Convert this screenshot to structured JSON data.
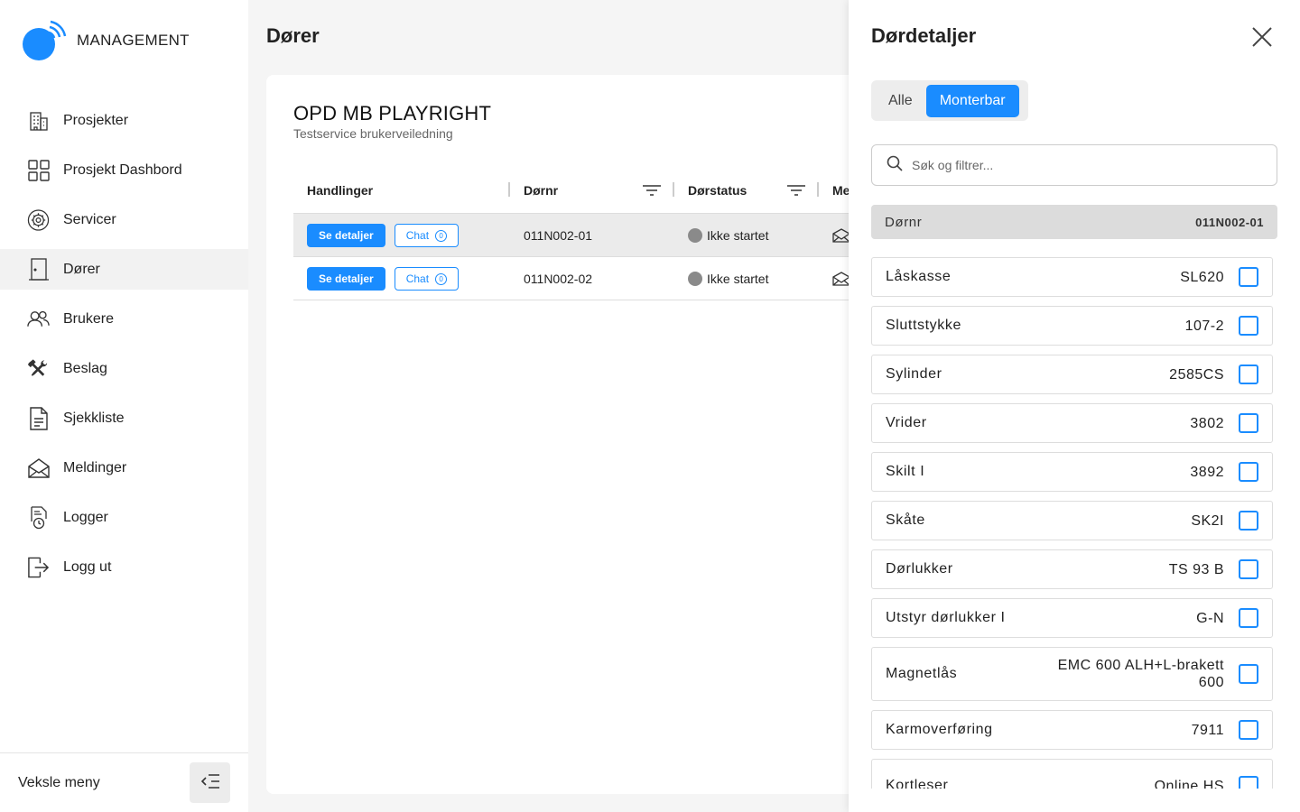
{
  "app": {
    "brand": "MANAGEMENT"
  },
  "sidebar": {
    "items": [
      {
        "label": "Prosjekter",
        "icon": "building-icon"
      },
      {
        "label": "Prosjekt Dashbord",
        "icon": "dashboard-grid-icon"
      },
      {
        "label": "Servicer",
        "icon": "gear-icon"
      },
      {
        "label": "Dører",
        "icon": "door-icon",
        "active": true
      },
      {
        "label": "Brukere",
        "icon": "users-icon"
      },
      {
        "label": "Beslag",
        "icon": "tools-icon"
      },
      {
        "label": "Sjekkliste",
        "icon": "document-icon"
      },
      {
        "label": "Meldinger",
        "icon": "mail-icon"
      },
      {
        "label": "Logger",
        "icon": "log-clock-icon"
      },
      {
        "label": "Logg ut",
        "icon": "logout-icon"
      }
    ],
    "footer": {
      "label": "Veksle meny"
    }
  },
  "main": {
    "title": "Dører",
    "project": {
      "title": "OPD MB PLAYRIGHT",
      "subtitle": "Testservice brukerveiledning"
    },
    "table": {
      "headers": {
        "actions": "Handlinger",
        "door": "Dørnr",
        "status": "Dørstatus",
        "more": "Me"
      },
      "rows": [
        {
          "details": "Se detaljer",
          "chat": "Chat",
          "chat_count": "0",
          "door": "011N002-01",
          "status": "Ikke startet",
          "selected": true
        },
        {
          "details": "Se detaljer",
          "chat": "Chat",
          "chat_count": "0",
          "door": "011N002-02",
          "status": "Ikke startet",
          "selected": false
        }
      ]
    }
  },
  "drawer": {
    "title": "Dørdetaljer",
    "tabs": {
      "all": "Alle",
      "mountable": "Monterbar"
    },
    "search_placeholder": "Søk og filtrer...",
    "door_label": "Dørnr",
    "door_value": "011N002-01",
    "items": [
      {
        "name": "Låskasse",
        "value": "SL620"
      },
      {
        "name": "Sluttstykke",
        "value": "107-2"
      },
      {
        "name": "Sylinder",
        "value": "2585CS"
      },
      {
        "name": "Vrider",
        "value": "3802"
      },
      {
        "name": "Skilt I",
        "value": "3892"
      },
      {
        "name": "Skåte",
        "value": "SK2I"
      },
      {
        "name": "Dørlukker",
        "value": "TS 93 B"
      },
      {
        "name": "Utstyr dørlukker I",
        "value": "G-N"
      },
      {
        "name": "Magnetlås",
        "value": "EMC 600 ALH+L-brakett 600"
      },
      {
        "name": "Karmoverføring",
        "value": "7911"
      },
      {
        "name": "Kortleser",
        "value": "Online HS"
      }
    ]
  },
  "colors": {
    "accent": "#1a8cff",
    "status_not_started": "#8a8a8a"
  }
}
